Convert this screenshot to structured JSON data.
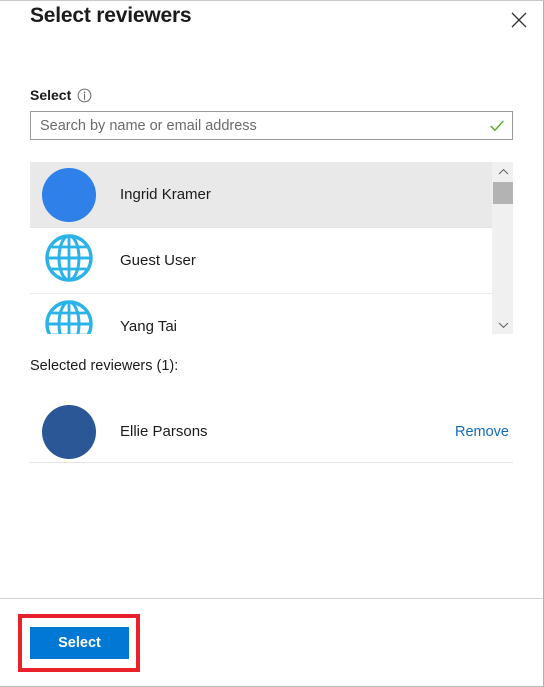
{
  "dialog": {
    "title": "Select reviewers",
    "close_icon": "close-icon"
  },
  "field": {
    "label": "Select",
    "info_icon": "info-icon"
  },
  "search": {
    "value": "",
    "placeholder": "Search by name or email address",
    "valid_icon": "checkmark-icon",
    "valid_color": "#5ea226"
  },
  "results": {
    "items": [
      {
        "name": "Ingrid Kramer",
        "avatar_type": "solid-bright",
        "avatar_color": "#2f80e8",
        "selected": true
      },
      {
        "name": "Guest User",
        "avatar_type": "globe",
        "avatar_color": "#2bb3e8",
        "selected": false
      },
      {
        "name": "Yang Tai",
        "avatar_type": "globe",
        "avatar_color": "#2bb3e8",
        "selected": false
      }
    ],
    "scrollbar": {
      "up_icon": "chevron-up-icon",
      "down_icon": "chevron-down-icon"
    }
  },
  "selected_section": {
    "heading": "Selected reviewers (1):",
    "items": [
      {
        "name": "Ellie Parsons",
        "avatar_type": "solid-dark",
        "avatar_color": "#2b5797",
        "remove_label": "Remove"
      }
    ]
  },
  "footer": {
    "select_label": "Select",
    "select_color": "#0078d4",
    "highlight_color": "#e8212b"
  }
}
